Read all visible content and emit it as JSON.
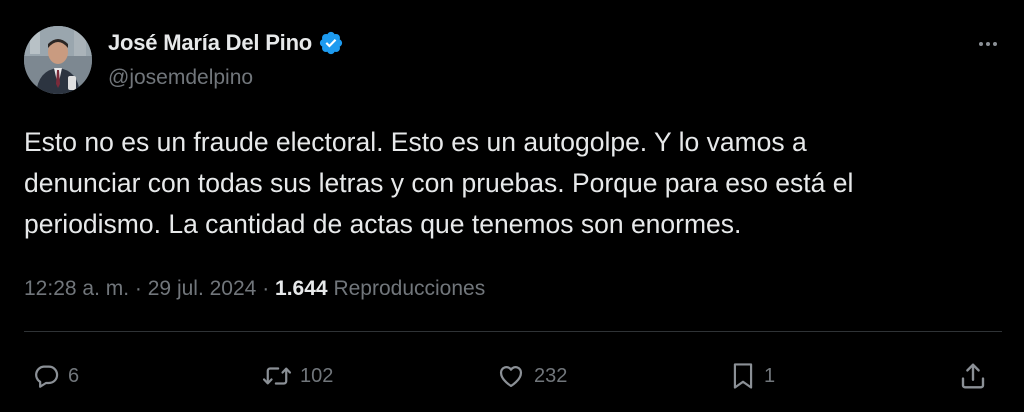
{
  "author": {
    "display_name": "José María Del Pino",
    "handle": "@josemdelpino",
    "verified": true
  },
  "tweet": {
    "lines": [
      "Esto no es un fraude electoral. Esto es un autogolpe. Y lo vamos a",
      "denunciar con todas sus letras y con pruebas. Porque para eso está el",
      "periodismo. La cantidad de actas que tenemos son enormes."
    ],
    "time": "12:28 a. m.",
    "date": "29 jul. 2024",
    "separator": "·",
    "views_count": "1.644",
    "views_label": "Reproducciones"
  },
  "actions": {
    "replies": "6",
    "retweets": "102",
    "likes": "232",
    "bookmarks": "1"
  },
  "icons": {
    "more": "more-horizontal-icon",
    "reply": "reply-icon",
    "retweet": "retweet-icon",
    "like": "heart-icon",
    "bookmark": "bookmark-icon",
    "share": "share-icon",
    "verified": "verified-badge-icon"
  },
  "colors": {
    "background": "#000000",
    "text": "#e7e9ea",
    "muted": "#71767b",
    "divider": "#2f3336",
    "verified": "#1d9bf0"
  }
}
